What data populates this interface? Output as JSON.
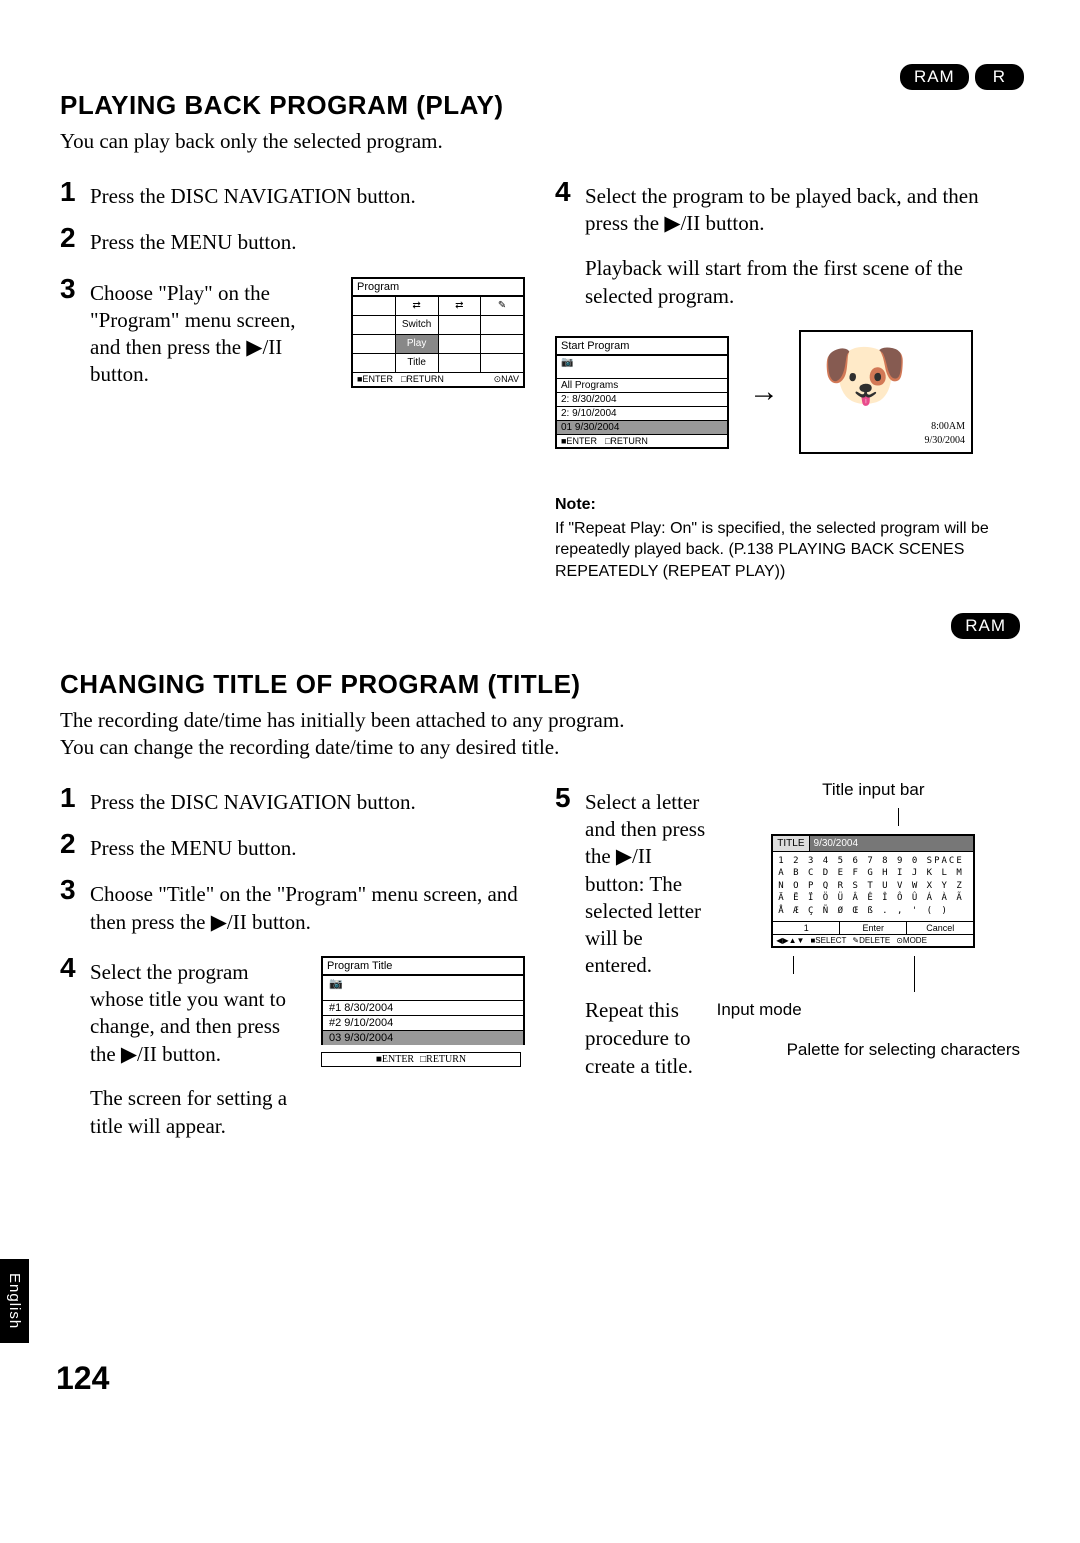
{
  "badges": {
    "ram": "RAM",
    "r": "R"
  },
  "section1": {
    "title": "PLAYING BACK PROGRAM (PLAY)",
    "intro": "You can play back only the selected program.",
    "steps_left": [
      {
        "n": "1",
        "text": "Press the DISC NAVIGATION button."
      },
      {
        "n": "2",
        "text": "Press the MENU button."
      },
      {
        "n": "3",
        "text": "Choose \"Play\" on the \"Program\" menu screen, and then press the ▶/II button."
      }
    ],
    "steps_right": [
      {
        "n": "4",
        "text": "Select the program to be played back, and then press the ▶/II button."
      }
    ],
    "right_para": "Playback will start from the first scene of the selected program.",
    "note_title": "Note:",
    "note_text": "If \"Repeat Play: On\" is specified, the selected program will be repeatedly played back. (P.138 PLAYING BACK SCENES REPEATEDLY (REPEAT PLAY))",
    "menu_fig": {
      "title": "Program",
      "row1": [
        "",
        "⇄",
        "⇄",
        "✎"
      ],
      "row2_label": "Switch",
      "row3_label": "Play",
      "row4_label": "Title",
      "footer": [
        "■ENTER",
        "□RETURN",
        "⊙NAV"
      ]
    },
    "start_fig": {
      "title": "Start Program",
      "rows": [
        "All Programs",
        "2: 8/30/2004",
        "2: 9/10/2004",
        "01 9/30/2004"
      ],
      "footer": [
        "■ENTER",
        "□RETURN"
      ]
    },
    "dog_fig": {
      "rec": "8:00AM",
      "date": "9/30/2004"
    }
  },
  "section2": {
    "title": "CHANGING TITLE OF PROGRAM (TITLE)",
    "intro1": "The recording date/time has initially been attached to any program.",
    "intro2": "You can change the recording date/time to any desired title.",
    "steps_left": [
      {
        "n": "1",
        "text": "Press the DISC NAVIGATION button."
      },
      {
        "n": "2",
        "text": "Press the MENU button."
      },
      {
        "n": "3",
        "text": "Choose \"Title\" on the \"Program\" menu screen, and then press the ▶/II button."
      },
      {
        "n": "4",
        "text": "Select the program whose title you want to change, and then press the ▶/II button."
      }
    ],
    "left_after": "The screen for setting a title will appear.",
    "steps_right": [
      {
        "n": "5",
        "text": "Select a letter and then press the ▶/II button: The selected letter will be entered."
      }
    ],
    "right_para": "Repeat this procedure to create a title.",
    "prog_title_fig": {
      "title": "Program Title",
      "rows": [
        "#1 8/30/2004",
        "#2 9/10/2004",
        "03 9/30/2004"
      ],
      "footer": [
        "■ENTER",
        "□RETURN"
      ]
    },
    "title_input_fig": {
      "label_title": "TITLE",
      "value": "9/30/2004",
      "palette_rows": [
        "1 2 3 4 5 6 7 8 9 0 SPACE",
        "A B C D E F G H I J K L M",
        "N O P Q R S T U V W X Y Z",
        "Ä Ë Ï Ö Ü Â Ê Î Ô Û Á À Ã",
        "Å Æ Ç Ñ Ø Œ ß . , ' ( )"
      ],
      "modes": [
        "1",
        "Enter",
        "Cancel"
      ],
      "footer": [
        "◀▶▲▼",
        "■SELECT",
        "✎DELETE",
        "⊙MODE"
      ]
    },
    "annot_top": "Title input bar",
    "annot_mid": "Input mode",
    "annot_bottom": "Palette for selecting characters"
  },
  "side_tab": "English",
  "page_number": "124"
}
